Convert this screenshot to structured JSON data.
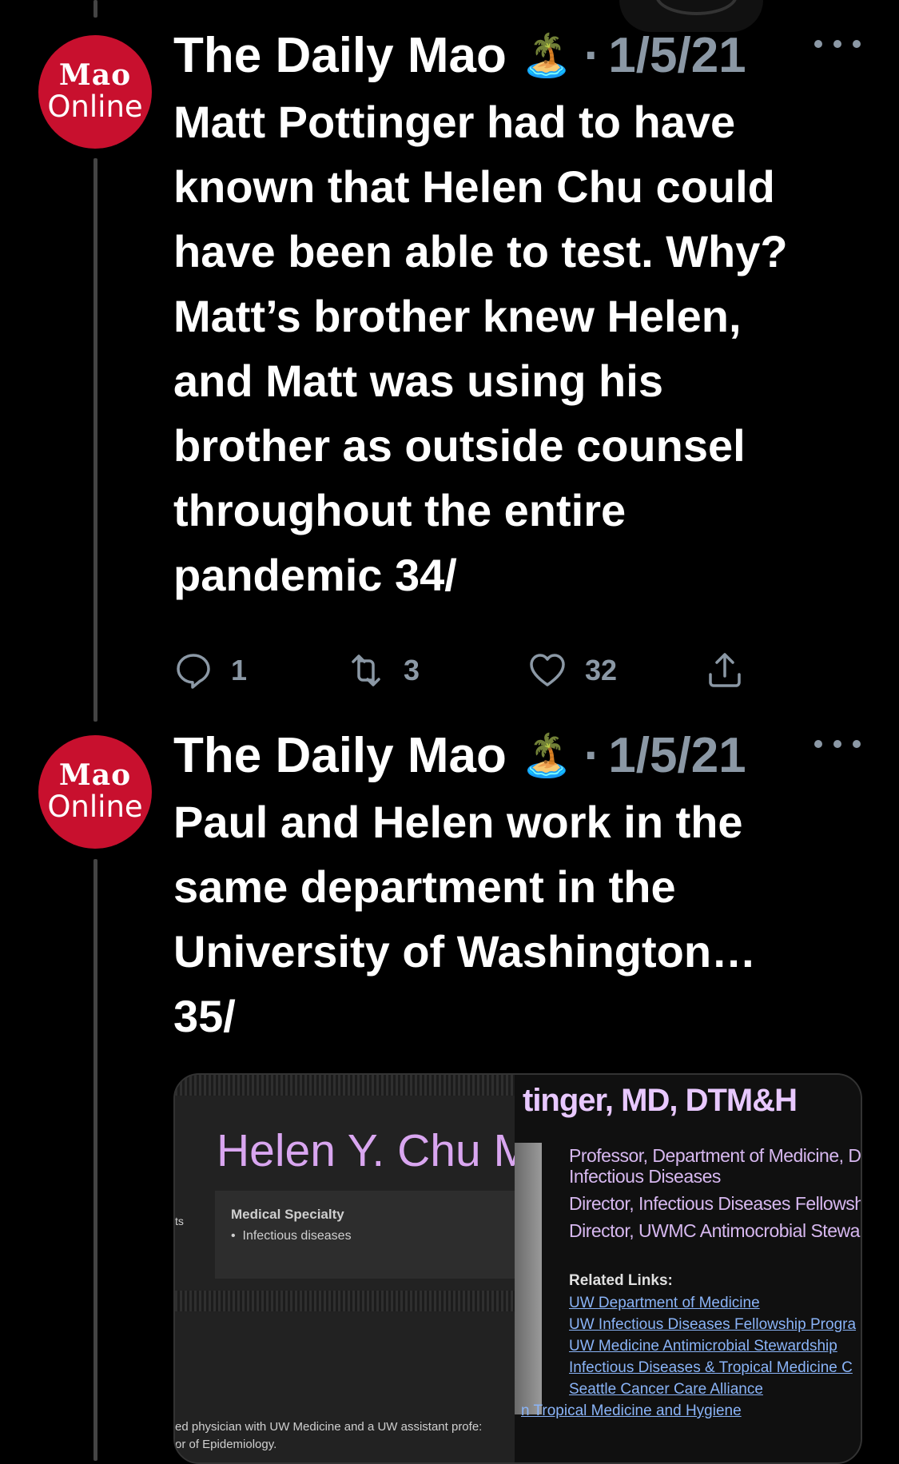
{
  "tweets": [
    {
      "account_name": "The Daily Mao",
      "name_emoji": "🏝️",
      "date": "1/5/21",
      "avatar": {
        "line1": "Mao",
        "line2": "Online"
      },
      "text_lines": [
        "Matt Pottinger had to have",
        "known that Helen Chu could",
        "have been able to test. Why?",
        "Matt’s brother knew Helen,",
        "and Matt was using his",
        "brother as outside counsel",
        "throughout the entire",
        "pandemic 34/"
      ],
      "replies": "1",
      "retweets": "3",
      "likes": "32"
    },
    {
      "account_name": "The Daily Mao",
      "name_emoji": "🏝️",
      "date": "1/5/21",
      "avatar": {
        "line1": "Mao",
        "line2": "Online"
      },
      "text_lines": [
        "Paul and Helen work in the",
        "same department in the",
        "University of Washington…",
        "35/"
      ]
    }
  ],
  "media": {
    "left": {
      "name": "Helen Y. Chu M",
      "side_fragment": "ts",
      "specialty_title": "Medical Specialty",
      "specialty_item": "Infectious diseases",
      "bottom_line1": "ed physician with UW Medicine and a UW assistant profe:",
      "bottom_line2": "or of Epidemiology."
    },
    "right": {
      "title": "tinger, MD, DTM&H",
      "positions": [
        "Professor, Department of Medicine, Di",
        "Infectious Diseases",
        "Director, Infectious Diseases Fellowshi",
        "Director, UWMC Antimocrobial Stewar"
      ],
      "related_label": "Related Links:",
      "links": [
        "UW Department of Medicine",
        "UW Infectious Diseases Fellowship Progra",
        "UW Medicine Antimicrobial Stewardship",
        "Infectious Diseases & Tropical Medicine C",
        "Seattle Cancer Care Alliance"
      ],
      "last_link": "n Tropical Medicine and Hygiene"
    }
  },
  "colors": {
    "background": "#000000",
    "avatar_red": "#c8102e",
    "muted": "#8b98a5",
    "link_blue": "#8ab4f8",
    "purple_heading": "#d9a6f0"
  },
  "icons": [
    "reply-icon",
    "retweet-icon",
    "like-icon",
    "share-icon",
    "more-icon"
  ]
}
